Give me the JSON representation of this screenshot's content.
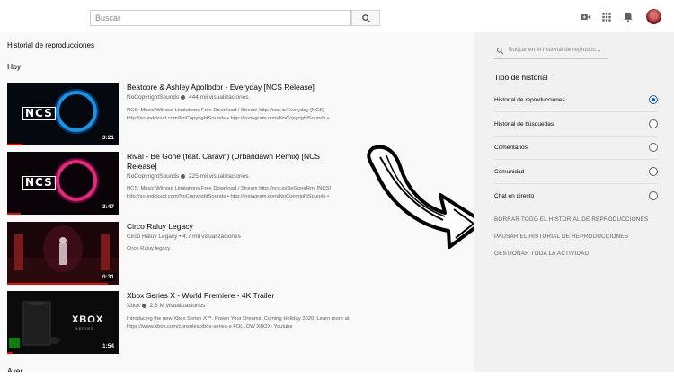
{
  "header": {
    "search_placeholder": "Buscar",
    "icons": [
      "search-icon",
      "video-camera-icon",
      "apps-grid-icon",
      "bell-icon",
      "avatar"
    ]
  },
  "main": {
    "title": "Historial de reproducciones",
    "section_today": "Hoy",
    "section_prev": "Ayer",
    "videos": [
      {
        "title": "Beatcore & Ashley Apollodor - Everyday [NCS Release]",
        "channel": "NoCopyrightSounds",
        "views": "444 mil visualizaciones",
        "desc1": "NCS: Music Without Limitations Free Download / Stream http://ncs.io/Everyday [NCS]",
        "desc2": "http://soundcloud.com/NoCopyrightSounds • http://instagram.com/NoCopyrightSounds •",
        "duration": "3:21",
        "progress": 0.14,
        "ncs": "NCS"
      },
      {
        "title": "Rival - Be Gone (feat. Caravn) (Urbandawn Remix) [NCS Release]",
        "channel": "NoCopyrightSounds",
        "views": "225 mil visualizaciones",
        "desc1": "NCS: Music Without Limitations Free Download / Stream http://ncs.io/BeGoneRmi [NCS]",
        "desc2": "http://soundcloud.com/NoCopyrightSounds • http://instagram.com/NoCopyrightSounds •",
        "duration": "3:47",
        "progress": 0.12,
        "ncs": "NCS"
      },
      {
        "title": "Circo Raluy Legacy",
        "channel": "Circo Raluy Legacy",
        "views": "4,7 mil visualizaciones",
        "desc1": "Circo Raluy legacy",
        "desc2": "",
        "duration": "0:31",
        "progress": 0.9
      },
      {
        "title": "Xbox Series X - World Premiere - 4K Trailer",
        "channel": "Xbox",
        "views": "2,6 M visualizaciones",
        "desc1": "Introducing the new Xbox Series X™. Power Your Dreams. Coming Holiday 2020. Learn more at",
        "desc2": "https://www.xbox.com/consoles/xbox-series-x FOLLOW XBOX: Youtube",
        "duration": "1:54",
        "progress": 0.05,
        "logo": "XBOX",
        "logo_sub": "SERIES"
      }
    ]
  },
  "sidebar": {
    "search_placeholder": "Buscar en el historial de reproduc...",
    "type_title": "Tipo de historial",
    "options": [
      {
        "label": "Historial de reproducciones",
        "selected": true
      },
      {
        "label": "Historial de búsquedas",
        "selected": false
      },
      {
        "label": "Comentarios",
        "selected": false
      },
      {
        "label": "Comunidad",
        "selected": false
      },
      {
        "label": "Chat en directo",
        "selected": false
      }
    ],
    "actions": [
      "BORRAR TODO EL HISTORIAL DE REPRODUCCIONES",
      "PAUSAR EL HISTORIAL DE REPRODUCCIONES",
      "GESTIONAR TODA LA ACTIVIDAD"
    ]
  },
  "colors": {
    "accent": "#065fd4",
    "progress": "#ff0000"
  }
}
